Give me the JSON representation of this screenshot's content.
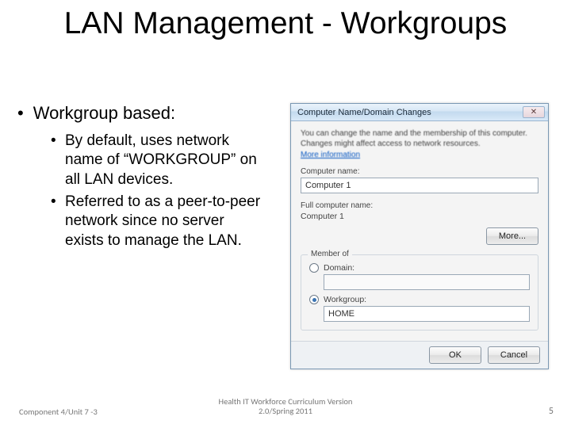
{
  "title": "LAN Management - Workgroups",
  "bullets": {
    "l1": "Workgroup based:",
    "l2a": "By default, uses network name of “WORKGROUP” on all LAN devices.",
    "l2b": "Referred to as a peer-to-peer network since no server exists to manage the LAN."
  },
  "dialog": {
    "title": "Computer Name/Domain Changes",
    "close_glyph": "✕",
    "desc": "You can change the name and the membership of this computer. Changes might affect access to network resources.",
    "more_info_link": "More information",
    "computer_name_label": "Computer name:",
    "computer_name_value": "Computer 1",
    "full_name_label": "Full computer name:",
    "full_name_value": "Computer 1",
    "more_button": "More...",
    "group_title": "Member of",
    "radio_domain": "Domain:",
    "domain_value": "",
    "radio_workgroup": "Workgroup:",
    "workgroup_value": "HOME",
    "ok": "OK",
    "cancel": "Cancel"
  },
  "footer": {
    "left": "Component 4/Unit 7 -3",
    "center_line1": "Health IT Workforce Curriculum Version",
    "center_line2": "2.0/Spring 2011",
    "page": "5"
  }
}
